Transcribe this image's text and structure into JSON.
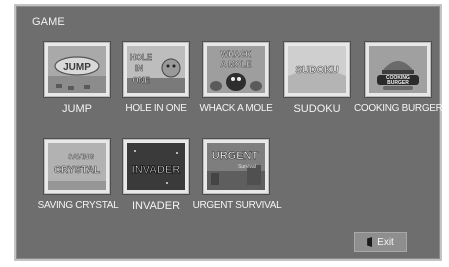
{
  "screen": {
    "title": "GAME"
  },
  "games": [
    {
      "label": "JUMP",
      "art_text": "JUMP",
      "icon": "jump-game-icon"
    },
    {
      "label": "HOLE IN ONE",
      "art_text": "HOLE IN ONE",
      "icon": "hole-in-one-game-icon"
    },
    {
      "label": "WHACK A MOLE",
      "art_text": "WHACK A MOLE",
      "icon": "whack-a-mole-game-icon"
    },
    {
      "label": "SUDOKU",
      "art_text": "SUDOKU",
      "icon": "sudoku-game-icon"
    },
    {
      "label": "COOKING BURGER",
      "art_text": "COOKING BURGER",
      "icon": "cooking-burger-game-icon"
    },
    {
      "label": "SAVING CRYSTAL",
      "art_text": "SAVING CRYSTAL",
      "icon": "saving-crystal-game-icon"
    },
    {
      "label": "INVADER",
      "art_text": "INVADER",
      "icon": "invader-game-icon"
    },
    {
      "label": "URGENT SURVIVAL",
      "art_text": "URGENT",
      "art_subtext": "Survival",
      "icon": "urgent-survival-game-icon"
    }
  ],
  "exit_button": {
    "label": "Exit",
    "icon": "door-icon"
  },
  "colors": {
    "background": "#6e6e6e",
    "frame": "#c4c4c4",
    "text": "#f4f4f4",
    "exit": "#8e8e8e"
  }
}
